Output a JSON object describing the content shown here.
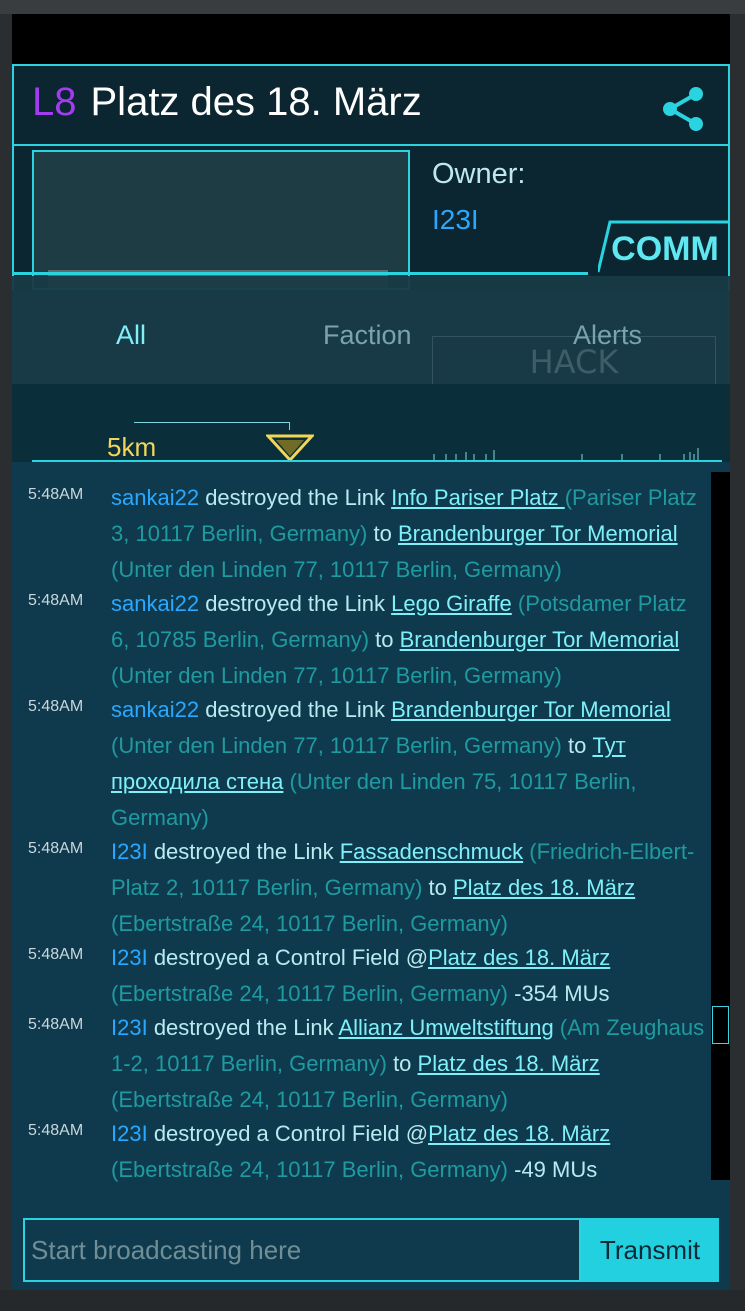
{
  "portal": {
    "level": "L8",
    "name": "Platz des 18. März",
    "owner_label": "Owner:",
    "owner_name": "I23I"
  },
  "comm": {
    "label": "COMM",
    "tabs": [
      "All",
      "Faction",
      "Alerts"
    ],
    "selected_tab": "All"
  },
  "range": {
    "label": "5km"
  },
  "feed": [
    {
      "time": "5:48AM",
      "agent": "sankai22",
      "action": " destroyed the Link ",
      "from_name": "Info Pariser Platz ",
      "from_addr": " (Pariser Platz 3, 10117 Berlin, Germany)",
      "join": " to ",
      "to_name": "Brandenburger Tor Memorial",
      "to_addr": " (Unter den Linden 77, 10117 Berlin, Germany)"
    },
    {
      "time": "5:48AM",
      "agent": "sankai22",
      "action": " destroyed the Link ",
      "from_name": "Lego Giraffe",
      "from_addr": " (Potsdamer Platz 6, 10785 Berlin, Germany)",
      "join": " to ",
      "to_name": "Brandenburger Tor Memorial",
      "to_addr": " (Unter den Linden 77, 10117 Berlin, Germany)"
    },
    {
      "time": "5:48AM",
      "agent": "sankai22",
      "action": " destroyed the Link ",
      "from_name": "Brandenburger Tor Memorial",
      "from_addr": " (Unter den Linden 77, 10117 Berlin, Germany)",
      "join": " to ",
      "to_name": "Тут проходила стена",
      "to_addr": " (Unter den Linden 75, 10117 Berlin, Germany)"
    },
    {
      "time": "5:48AM",
      "agent": "I23I",
      "action": " destroyed the Link ",
      "from_name": "Fassadenschmuck",
      "from_addr": " (Friedrich-Elbert-Platz 2, 10117 Berlin, Germany)",
      "join": " to ",
      "to_name": "Platz des 18. März",
      "to_addr": " (Ebertstraße 24, 10117 Berlin, Germany)"
    },
    {
      "time": "5:48AM",
      "agent": "I23I",
      "action": " destroyed a Control Field @",
      "portal_name": "Platz des 18. März",
      "portal_addr": " (Ebertstraße 24, 10117 Berlin, Germany)",
      "mus": " -354 MUs"
    },
    {
      "time": "5:48AM",
      "agent": "I23I",
      "action": " destroyed the Link ",
      "from_name": "Allianz Umweltstiftung",
      "from_addr": " (Am Zeughaus 1-2, 10117 Berlin, Germany)",
      "join": " to ",
      "to_name": "Platz des 18. März",
      "to_addr": " (Ebertstraße 24, 10117 Berlin, Germany)"
    },
    {
      "time": "5:48AM",
      "agent": "I23I",
      "action": " destroyed a Control Field @",
      "portal_name": "Platz des 18. März",
      "portal_addr": " (Ebertstraße 24, 10117 Berlin, Germany)",
      "mus": " -49 MUs"
    }
  ],
  "broadcast": {
    "placeholder": "Start broadcasting here",
    "button": "Transmit"
  },
  "colors": {
    "accent": "#2ad3e0",
    "level": "#a13cf0",
    "agent": "#2aa8ff",
    "range_label": "#f2d65a"
  }
}
